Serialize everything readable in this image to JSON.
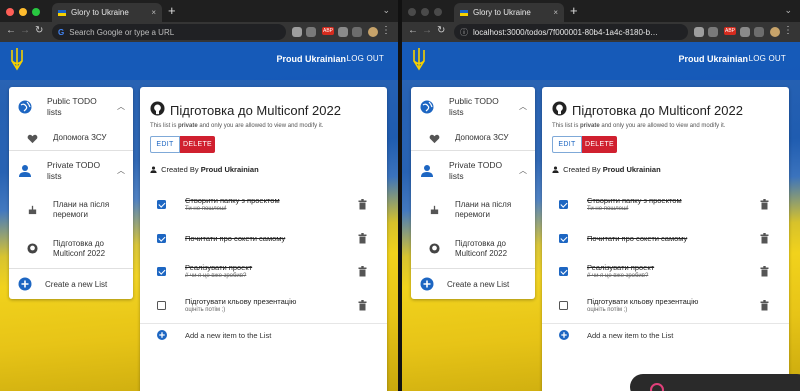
{
  "browser": {
    "tab_title": "Glory to Ukraine",
    "left_address_placeholder": "Search Google or type a URL",
    "right_address_url": "localhost:3000/todos/7f000001-80b4-1a4c-8180-b…",
    "abp_label": "ABP",
    "new_tab_symbol": "+",
    "close_symbol": "×"
  },
  "appbar": {
    "user_name": "Proud Ukrainian",
    "logout_label": "LOG OUT"
  },
  "sidebar": {
    "public_header": "Public TODO lists",
    "public_items": [
      "Допомога ЗСУ"
    ],
    "private_header": "Private TODO lists",
    "private_items": [
      "Плани на після перемоги",
      "Підготовка до Multiconf 2022"
    ],
    "create_label": "Create a new List"
  },
  "list": {
    "title": "Підготовка до Multiconf 2022",
    "privacy_pre": "This list is ",
    "privacy_word": "private",
    "privacy_post": " and only you are allowed to view and modify it.",
    "edit_label": "EDIT",
    "delete_label": "DELETE",
    "created_by_label": "Created By",
    "created_by_name": "Proud Ukrainian",
    "items": [
      {
        "title": "Створити папку з проектом",
        "note": "Ти не пошлеш!",
        "done": true
      },
      {
        "title": "Почитати про сокети самому",
        "note": "",
        "done": true
      },
      {
        "title": "Реалізувати проект",
        "note": "// чи я це вже зробив?",
        "done": true
      },
      {
        "title": "Підготувати кльову презентацію",
        "note": "оцініть потім ;)",
        "done": false
      }
    ],
    "add_item_label": "Add a new item to the List"
  },
  "colors": {
    "appbar": "#1559b8",
    "primary": "#1d66c2",
    "danger": "#d0202f",
    "flag_blue": "#1f5cb0",
    "flag_yellow": "#f1d21c"
  },
  "icons": [
    "globe-icon",
    "heart-icon",
    "person-icon",
    "cake-icon",
    "github-icon",
    "add-circle-icon",
    "trash-icon",
    "chevron-up-icon",
    "trident-icon"
  ]
}
